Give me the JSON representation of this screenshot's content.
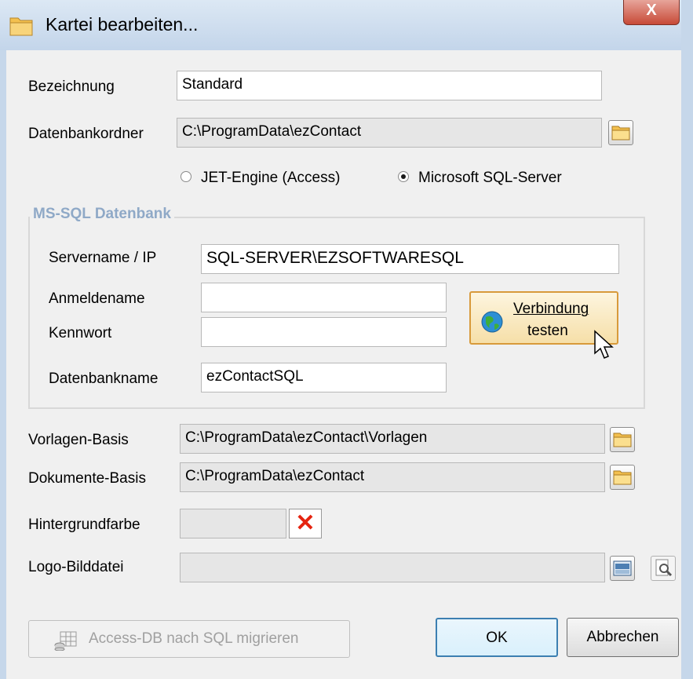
{
  "window": {
    "title": "Kartei bearbeiten...",
    "close_label": "X"
  },
  "fields": {
    "bezeichnung": {
      "label": "Bezeichnung",
      "value": "Standard"
    },
    "datenbankordner": {
      "label": "Datenbankordner",
      "value": "C:\\ProgramData\\ezContact"
    }
  },
  "engine": {
    "options": [
      {
        "label": "JET-Engine (Access)",
        "selected": false
      },
      {
        "label": "Microsoft SQL-Server",
        "selected": true
      }
    ]
  },
  "mssql": {
    "group_title": "MS-SQL Datenbank",
    "servername": {
      "label": "Servername / IP",
      "value": "SQL-SERVER\\EZSOFTWARESQL"
    },
    "anmeldename": {
      "label": "Anmeldename",
      "value": ""
    },
    "kennwort": {
      "label": "Kennwort",
      "value": ""
    },
    "datenbankname": {
      "label": "Datenbankname",
      "value": "ezContactSQL"
    },
    "test_button": {
      "line1": "Verbindung",
      "line2": "testen"
    }
  },
  "paths": {
    "vorlagen": {
      "label": "Vorlagen-Basis",
      "value": "C:\\ProgramData\\ezContact\\Vorlagen"
    },
    "dokumente": {
      "label": "Dokumente-Basis",
      "value": "C:\\ProgramData\\ezContact"
    },
    "hintergrund": {
      "label": "Hintergrundfarbe",
      "value": ""
    },
    "logo": {
      "label": "Logo-Bilddatei",
      "value": ""
    }
  },
  "buttons": {
    "migrate": "Access-DB nach SQL migrieren",
    "ok": "OK",
    "cancel": "Abbrechen"
  },
  "colors": {
    "group_title": "#8fa9c7",
    "clear_x": "#e52410",
    "ok_border": "#3c7fb1",
    "test_button_border": "#d89a3b"
  }
}
